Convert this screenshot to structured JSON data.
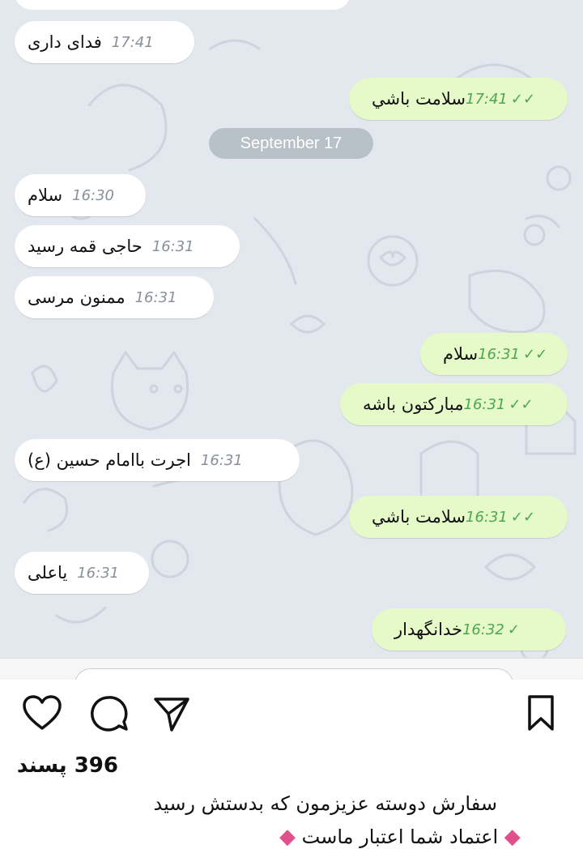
{
  "chat": {
    "date_separator": "September 17",
    "messages": [
      {
        "dir": "in",
        "text": "فدای داری",
        "time": "17:41"
      },
      {
        "dir": "out",
        "text": "سلامت باشي",
        "time": "17:41",
        "status": "read"
      },
      {
        "dir": "in",
        "text": "سلام",
        "time": "16:30"
      },
      {
        "dir": "in",
        "text": "حاجی قمه رسید",
        "time": "16:31"
      },
      {
        "dir": "in",
        "text": "ممنون مرسی",
        "time": "16:31"
      },
      {
        "dir": "out",
        "text": "سلام",
        "time": "16:31",
        "status": "read"
      },
      {
        "dir": "out",
        "text": "مبارکتون باشه",
        "time": "16:31",
        "status": "read"
      },
      {
        "dir": "in",
        "text": "اجرت باامام حسین (ع)",
        "time": "16:31"
      },
      {
        "dir": "out",
        "text": "سلامت باشي",
        "time": "16:31",
        "status": "read"
      },
      {
        "dir": "in",
        "text": "یاعلی",
        "time": "16:31"
      },
      {
        "dir": "out",
        "text": "خدانگهدار",
        "time": "16:32",
        "status": "sent"
      }
    ],
    "check_read": "✓✓",
    "check_sent": "✓",
    "colors": {
      "background": "#e3e8ee",
      "incoming": "#ffffff",
      "outgoing": "#e6f9c8",
      "time_out": "#4ea652"
    }
  },
  "post": {
    "icons": [
      "heart-icon",
      "comment-icon",
      "share-icon",
      "bookmark-icon"
    ],
    "likes": "396 پسند",
    "caption_line1": "سفارش دوسته عزیزمون که بدستش رسید",
    "caption_line2": "اعتماد شما اعتبار ماست",
    "diamond": "◆"
  }
}
